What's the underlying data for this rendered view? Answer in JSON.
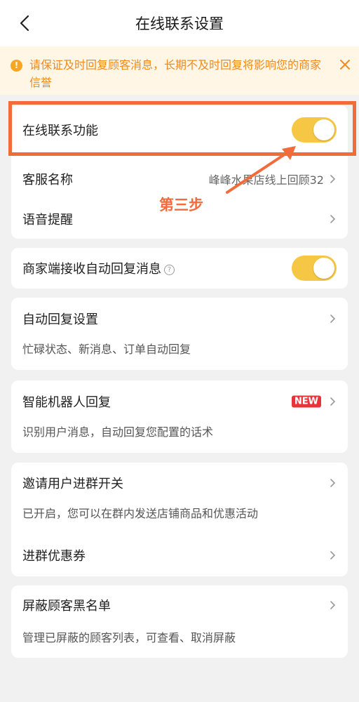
{
  "header": {
    "title": "在线联系设置"
  },
  "notice": {
    "text": "请保证及时回复顾客消息，长期不及时回复将影响您的商家信誉",
    "warn_glyph": "!"
  },
  "online_contact": {
    "label": "在线联系功能",
    "enabled": true
  },
  "service": {
    "name_label": "客服名称",
    "name_value": "峰峰水果店线上回顾32",
    "voice_label": "语音提醒"
  },
  "auto_receive": {
    "label": "商家端接收自动回复消息",
    "help_glyph": "?",
    "enabled": true
  },
  "auto_reply": {
    "title": "自动回复设置",
    "subtitle": "忙碌状态、新消息、订单自动回复"
  },
  "robot": {
    "title": "智能机器人回复",
    "badge": "NEW",
    "subtitle": "识别用户消息，自动回复您配置的话术"
  },
  "group": {
    "title": "邀请用户进群开关",
    "subtitle": "已开启，您可以在群内发送店铺商品和优惠活动",
    "coupon_label": "进群优惠券"
  },
  "blacklist": {
    "title": "屏蔽顾客黑名单",
    "subtitle": "管理已屏蔽的顾客列表，可查看、取消屏蔽"
  },
  "annotation": {
    "text": "第三步"
  },
  "colors": {
    "accent_toggle": "#f6c744",
    "annotation": "#f26b3a",
    "notice_text": "#f08a1c",
    "badge": "#e8333a"
  }
}
